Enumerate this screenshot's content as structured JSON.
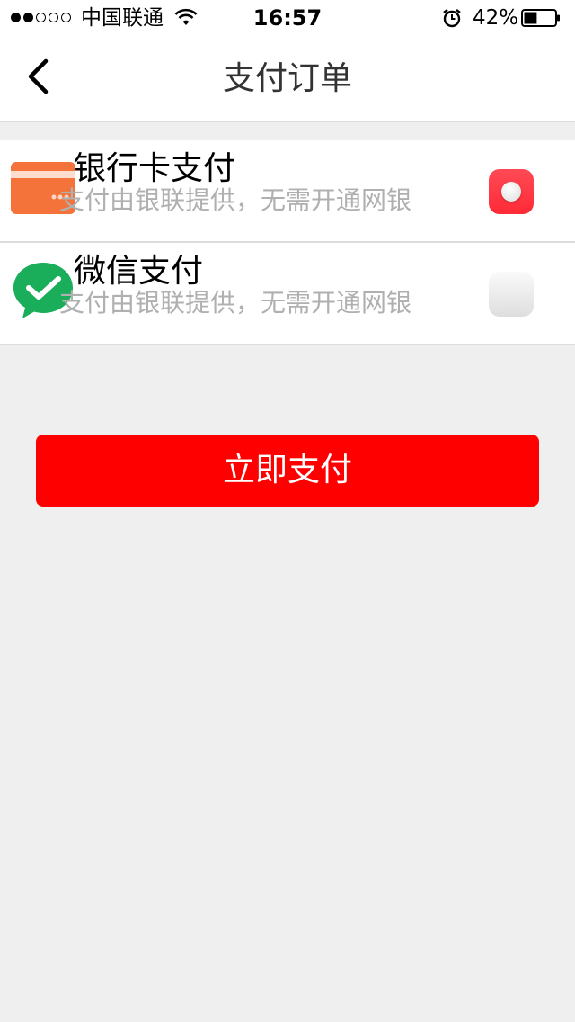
{
  "status_bar": {
    "carrier": "中国联通",
    "time": "16:57",
    "battery": "42%",
    "battery_level": 0.42,
    "signal_strength": 2,
    "signal_max": 5
  },
  "nav": {
    "title": "支付订单",
    "back_icon": "chevron-left-icon"
  },
  "payment_options": [
    {
      "title": "银行卡支付",
      "subtitle": "支付由银联提供，无需开通网银",
      "icon": "bank-card-icon",
      "selected": true
    },
    {
      "title": "微信支付",
      "subtitle": "支付由银联提供，无需开通网银",
      "icon": "wechat-pay-icon",
      "selected": false
    }
  ],
  "pay_button": {
    "label": "立即支付"
  },
  "colors": {
    "accent": "#ff0000",
    "background": "#efefef",
    "card_orange": "#f4733a",
    "wechat_green": "#1aad5a"
  }
}
